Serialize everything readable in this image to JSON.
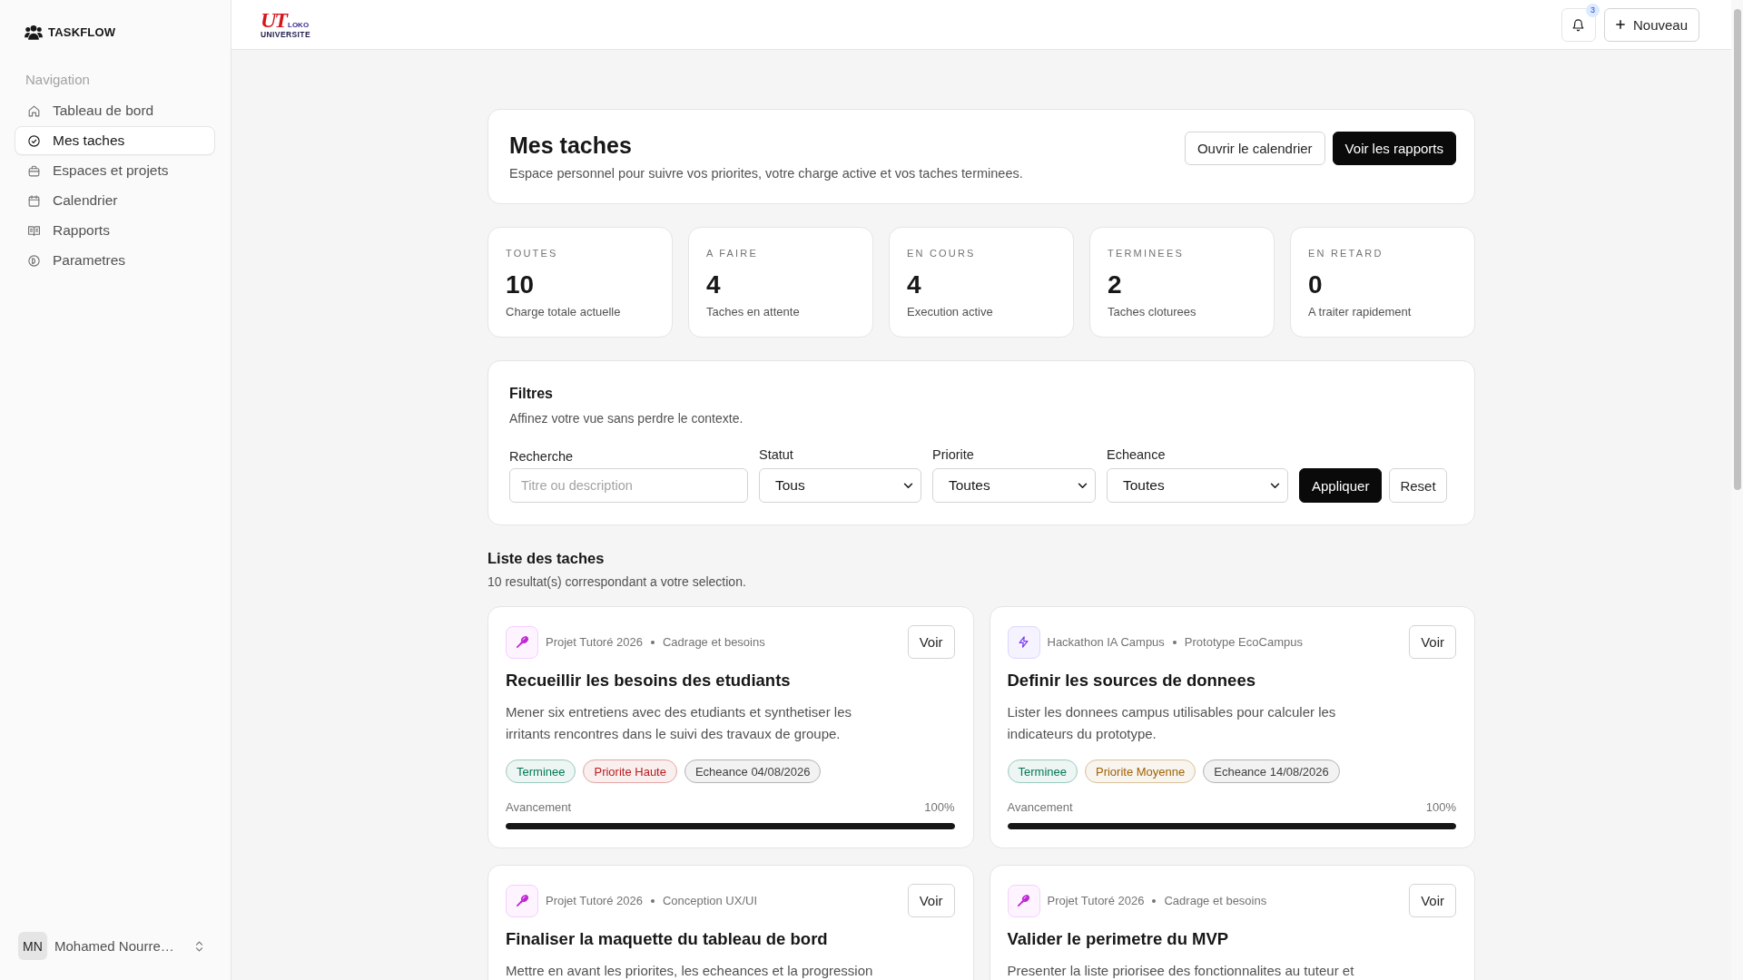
{
  "sidebar": {
    "brand": "TASKFLOW",
    "section_title": "Navigation",
    "items": [
      {
        "label": "Tableau de bord",
        "selected": false
      },
      {
        "label": "Mes taches",
        "selected": true
      },
      {
        "label": "Espaces et projets",
        "selected": false
      },
      {
        "label": "Calendrier",
        "selected": false
      },
      {
        "label": "Rapports",
        "selected": false
      },
      {
        "label": "Parametres",
        "selected": false
      }
    ],
    "user": {
      "initials": "MN",
      "name": "Mohamed Nourre…"
    }
  },
  "header": {
    "logo": {
      "mark": "UT",
      "name": "LOKO",
      "subtitle": "UNIVERSITE"
    },
    "notifications": {
      "count": "3"
    },
    "new_button": "Nouveau"
  },
  "page": {
    "title": "Mes taches",
    "subtitle": "Espace personnel pour suivre vos priorites, votre charge active et vos taches terminees.",
    "buttons": [
      {
        "label": "Ouvrir le calendrier",
        "kind": "secondary"
      },
      {
        "label": "Voir les rapports",
        "kind": "primary"
      }
    ]
  },
  "stats": [
    {
      "label": "TOUTES",
      "value": "10",
      "caption": "Charge totale actuelle"
    },
    {
      "label": "A FAIRE",
      "value": "4",
      "caption": "Taches en attente"
    },
    {
      "label": "EN COURS",
      "value": "4",
      "caption": "Execution active"
    },
    {
      "label": "TERMINEES",
      "value": "2",
      "caption": "Taches cloturees"
    },
    {
      "label": "EN RETARD",
      "value": "0",
      "caption": "A traiter rapidement"
    }
  ],
  "filters": {
    "title": "Filtres",
    "subtitle": "Affinez votre vue sans perdre le contexte.",
    "search": {
      "label": "Recherche",
      "placeholder": "Titre ou description"
    },
    "selects": [
      {
        "label": "Statut",
        "value": "Tous"
      },
      {
        "label": "Priorite",
        "value": "Toutes"
      },
      {
        "label": "Echeance",
        "value": "Toutes"
      }
    ],
    "buttons": [
      {
        "label": "Appliquer",
        "kind": "primary"
      },
      {
        "label": "Reset",
        "kind": "secondary"
      }
    ]
  },
  "task_list": {
    "title": "Liste des taches",
    "summary": "10 resultat(s) correspondant a votre selection.",
    "tasks": [
      {
        "kind": "project",
        "space": "Projet Tutoré 2026",
        "phase": "Cadrage et besoins",
        "action": "Voir",
        "title": "Recueillir les besoins des etudiants",
        "description": "Mener six entretiens avec des etudiants et synthetiser les irritants rencontres dans le suivi des travaux de groupe.",
        "tags": [
          {
            "label": "Terminee",
            "color": "#047857"
          },
          {
            "label": "Priorite Haute",
            "color": "#b91c1c"
          },
          {
            "label": "Echeance 04/08/2026",
            "color": "#404040"
          }
        ],
        "progress": {
          "label": "Avancement",
          "reading": "100%",
          "level": 1
        }
      },
      {
        "kind": "hackathon",
        "space": "Hackathon IA Campus",
        "phase": "Prototype EcoCampus",
        "action": "Voir",
        "title": "Definir les sources de donnees",
        "description": "Lister les donnees campus utilisables pour calculer les indicateurs du prototype.",
        "tags": [
          {
            "label": "Terminee",
            "color": "#047857"
          },
          {
            "label": "Priorite Moyenne",
            "color": "#a16207"
          },
          {
            "label": "Echeance 14/08/2026",
            "color": "#404040"
          }
        ],
        "progress": {
          "label": "Avancement",
          "reading": "100%",
          "level": 1
        }
      },
      {
        "kind": "project",
        "space": "Projet Tutoré 2026",
        "phase": "Conception UX/UI",
        "action": "Voir",
        "title": "Finaliser la maquette du tableau de bord",
        "description": "Mettre en avant les priorites, les echeances et la progression"
      },
      {
        "kind": "project",
        "space": "Projet Tutoré 2026",
        "phase": "Cadrage et besoins",
        "action": "Voir",
        "title": "Valider le perimetre du MVP",
        "description": "Presenter la liste priorisee des fonctionnalites au tuteur et"
      }
    ]
  }
}
